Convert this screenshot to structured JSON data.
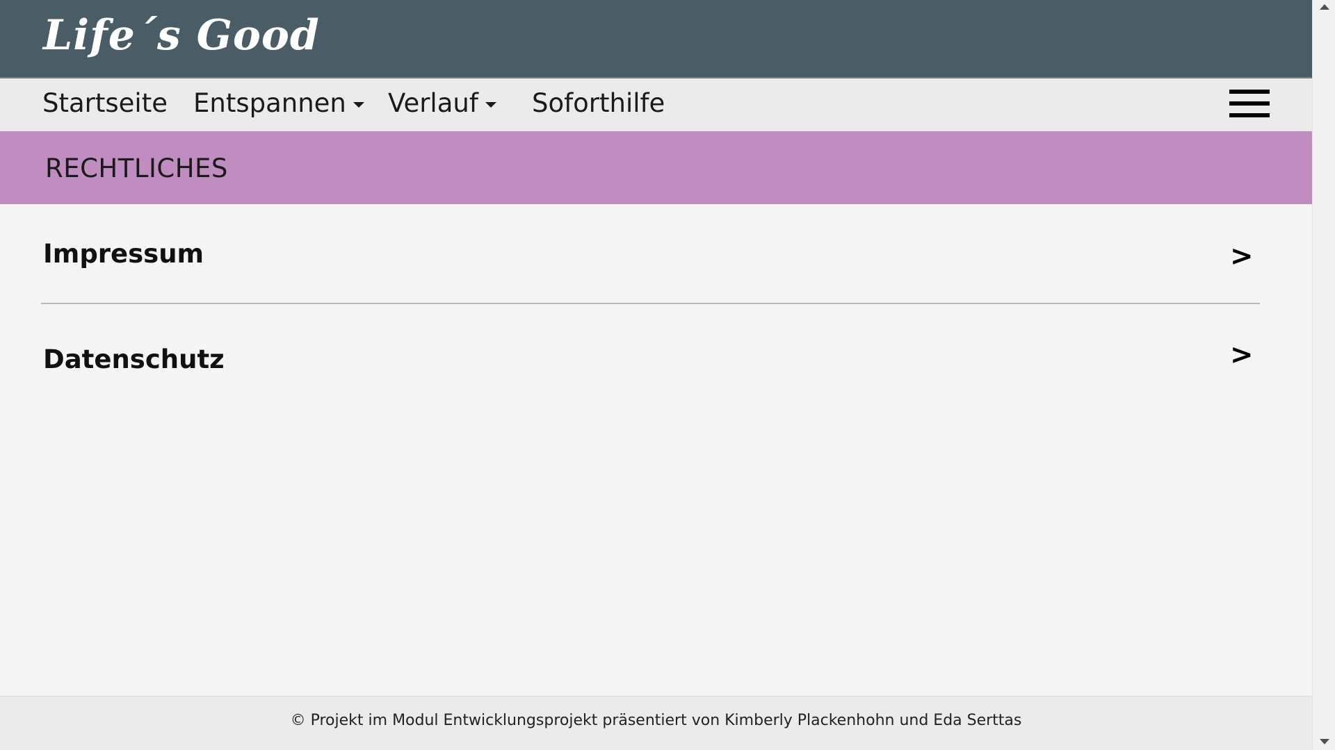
{
  "header": {
    "logo": "Life´s Good"
  },
  "nav": {
    "items": [
      {
        "label": "Startseite"
      },
      {
        "label": "Entspannen",
        "dropdown": true
      },
      {
        "label": "Verlauf",
        "dropdown": true
      },
      {
        "label": "Soforthilfe"
      }
    ],
    "menu_icon": "hamburger-menu-icon"
  },
  "banner": {
    "title": "RECHTLICHES"
  },
  "list": {
    "items": [
      {
        "label": "Impressum",
        "arrow": ">"
      },
      {
        "label": "Datenschutz",
        "arrow": ">"
      }
    ]
  },
  "footer": {
    "text": "© Projekt im Modul Entwicklungsprojekt präsentiert von Kimberly Plackenhohn und Eda Serttas"
  },
  "colors": {
    "header_bg": "#4a5d66",
    "nav_bg": "#ebebeb",
    "banner_bg": "#bf8dbf",
    "page_bg": "#f5f5f5"
  }
}
